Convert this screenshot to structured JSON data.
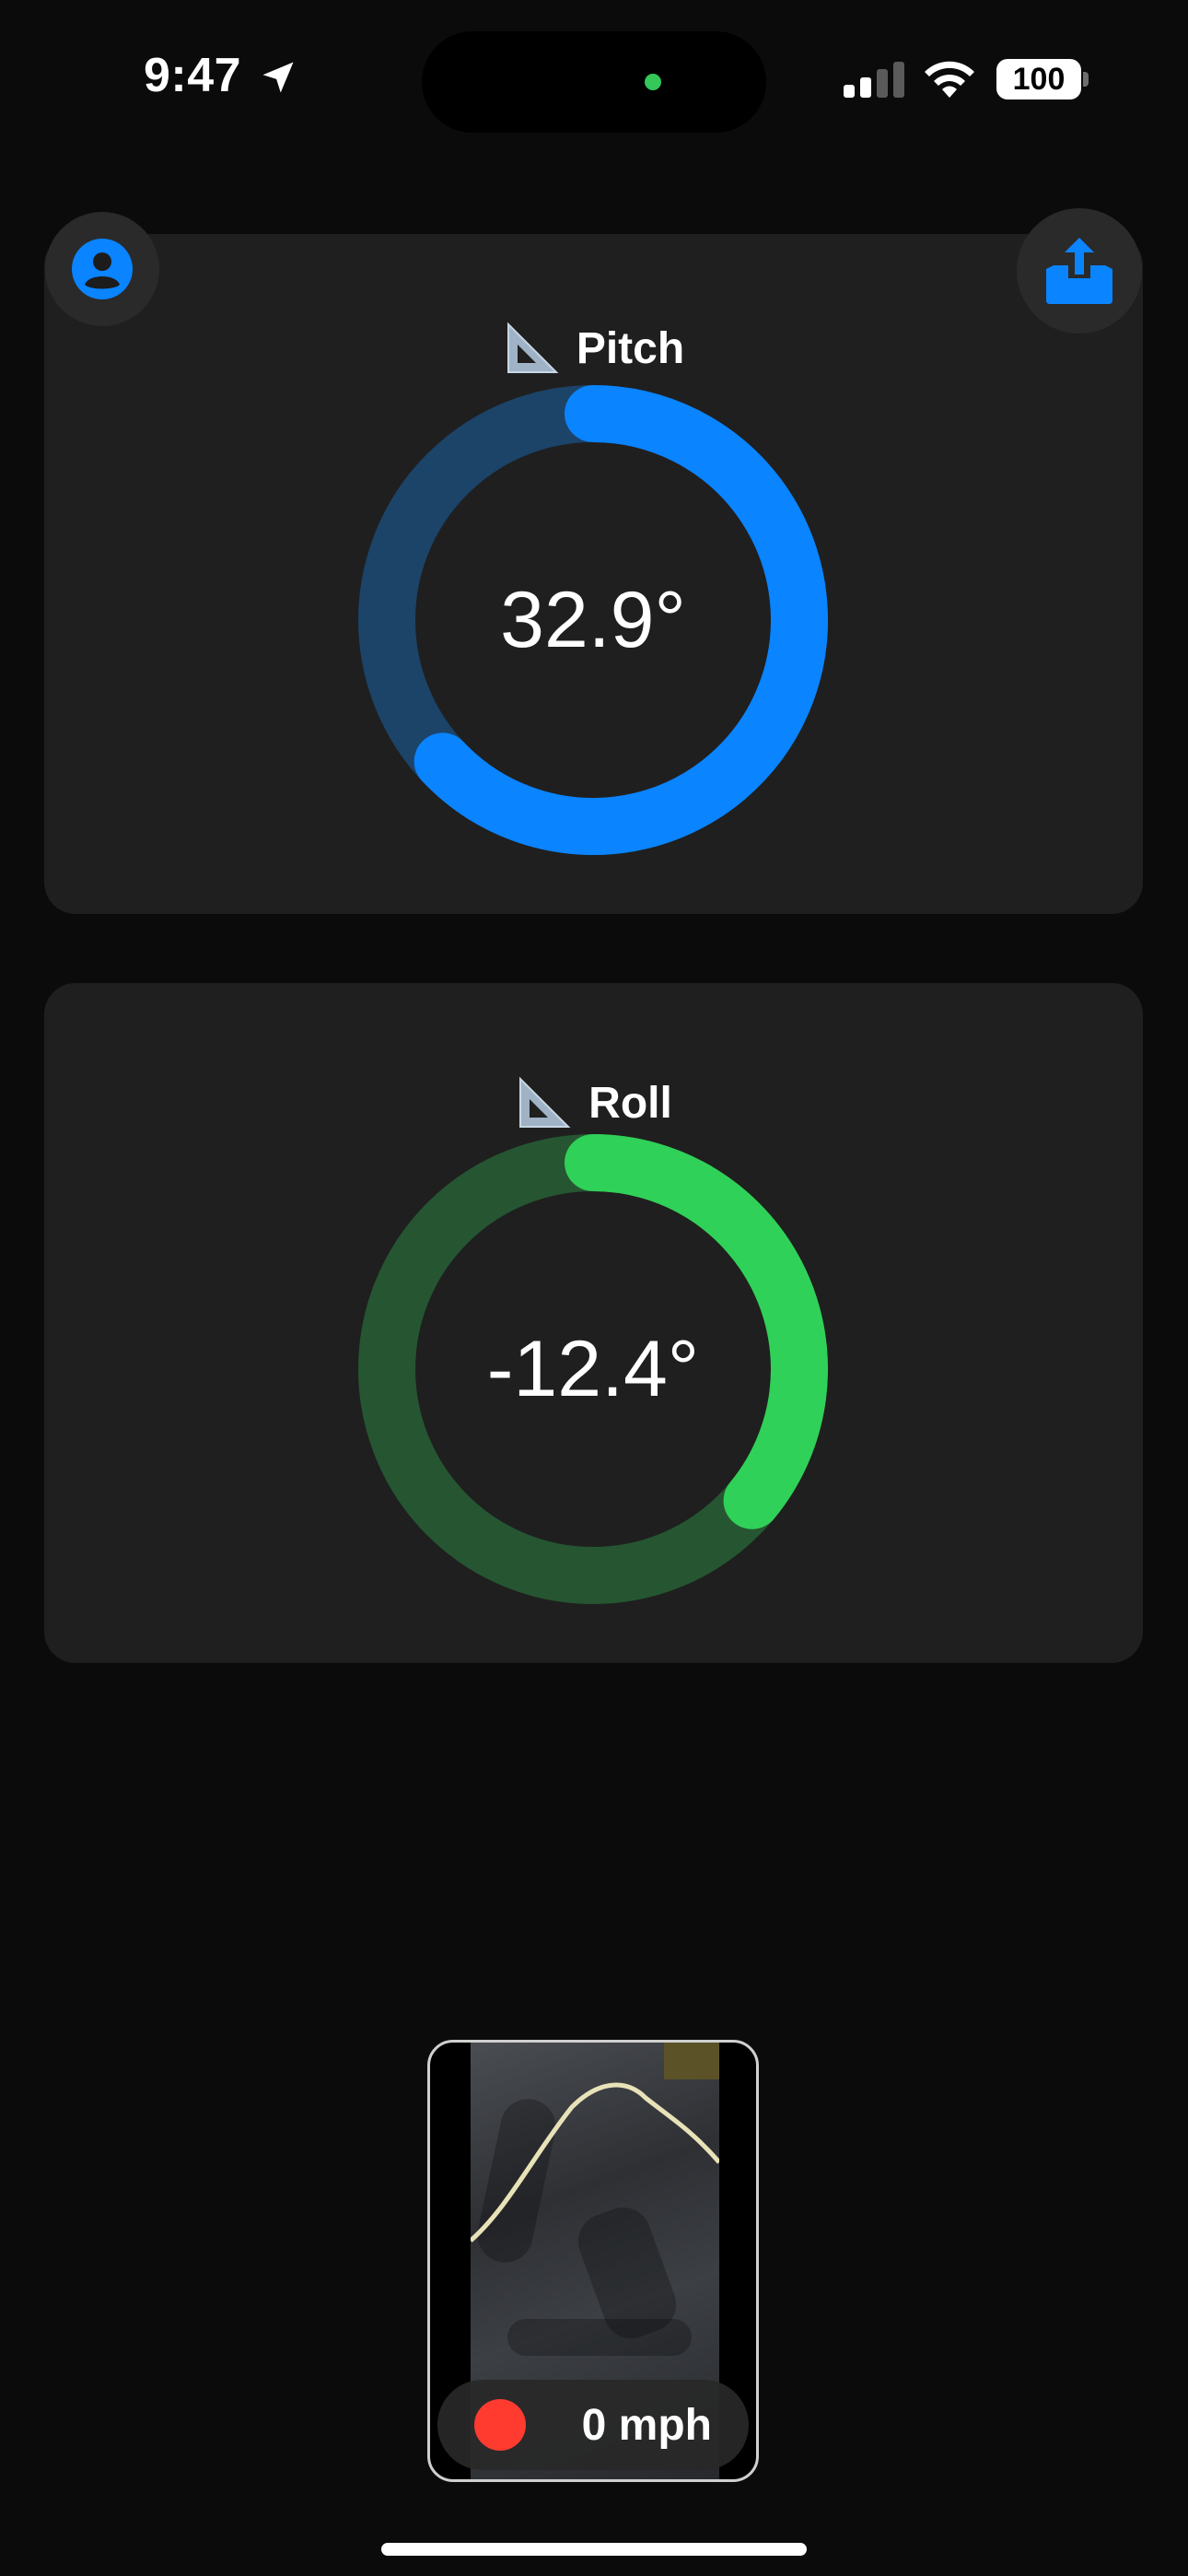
{
  "status_bar": {
    "time": "9:47",
    "battery": "100",
    "icons": [
      "location-arrow-icon",
      "cellular-signal-icon",
      "wifi-icon",
      "battery-icon"
    ]
  },
  "buttons": {
    "profile_icon": "person-circle-icon",
    "share_icon": "tray-upload-icon"
  },
  "pitch": {
    "label": "Pitch",
    "icon": "triangle-ruler-icon",
    "value": "32.9°",
    "progress_fraction": 0.63,
    "color_active": "#0a84ff",
    "color_track": "#1c4368"
  },
  "roll": {
    "label": "Roll",
    "icon": "triangle-ruler-icon",
    "value": "-12.4°",
    "progress_fraction": 0.36,
    "color_active": "#30d158",
    "color_track": "#255631"
  },
  "recorder": {
    "speed": "0 mph",
    "record_color": "#ff3b30"
  }
}
